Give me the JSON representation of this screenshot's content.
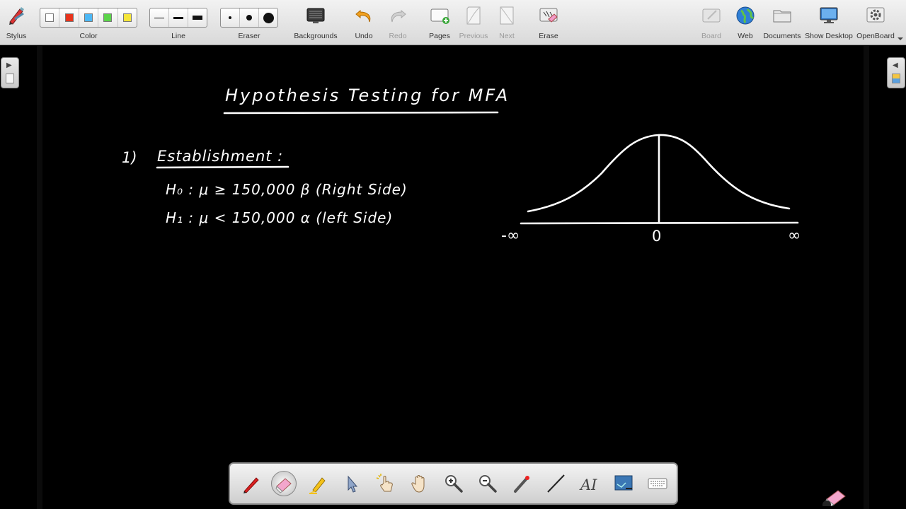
{
  "toolbar": {
    "stylus_label": "Stylus",
    "color_label": "Color",
    "colors": [
      "#ffffff",
      "#e8341c",
      "#4db8f5",
      "#5cd44a",
      "#f5e63a"
    ],
    "line_label": "Line",
    "eraser_label": "Eraser",
    "backgrounds_label": "Backgrounds",
    "undo_label": "Undo",
    "redo_label": "Redo",
    "pages_label": "Pages",
    "previous_label": "Previous",
    "next_label": "Next",
    "erase_label": "Erase",
    "board_label": "Board",
    "web_label": "Web",
    "documents_label": "Documents",
    "show_desktop_label": "Show Desktop",
    "openboard_label": "OpenBoard"
  },
  "board": {
    "title": "Hypothesis Testing for MFA",
    "step_number": "1)",
    "step_label": "Establishment :",
    "h0": "H₀ :  μ ≥ 150,000    β (Right Side)",
    "h1": "H₁ :  μ < 150,000    α (left Side)",
    "axis_neg_label": "-∞",
    "axis_zero_label": "0",
    "axis_pos_label": "∞"
  },
  "palette": {
    "tools": [
      "pen-tool",
      "eraser-tool",
      "marker-tool",
      "selector-tool",
      "interact-tool",
      "hand-tool",
      "zoom-in-tool",
      "zoom-out-tool",
      "laser-pointer-tool",
      "line-tool",
      "text-tool",
      "capture-tool",
      "virtual-keyboard-tool"
    ]
  }
}
